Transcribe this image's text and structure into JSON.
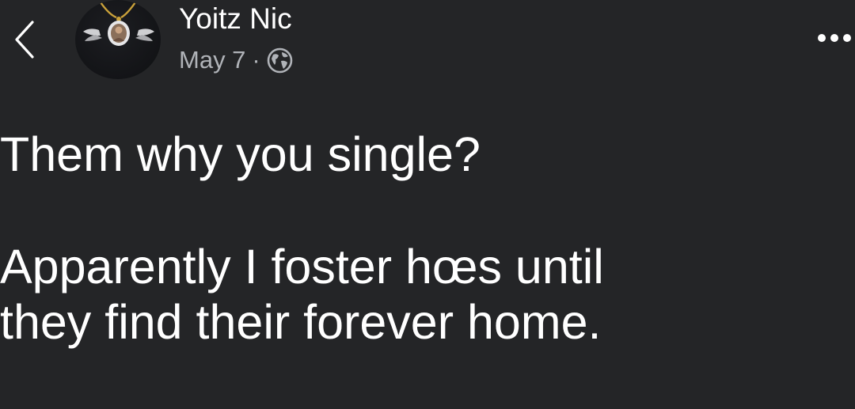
{
  "header": {
    "author_name": "Yoitz Nic",
    "date": "May 7",
    "separator": "·",
    "privacy_icon": "globe-icon",
    "back_icon": "chevron-left-icon",
    "more_icon": "more-dots-icon"
  },
  "post": {
    "text": "Them why you single?\n\nApparently I foster hœs until\nthey find their forever home."
  },
  "colors": {
    "background": "#242527",
    "primary_text": "#ffffff",
    "secondary_text": "#b0b3b8"
  }
}
